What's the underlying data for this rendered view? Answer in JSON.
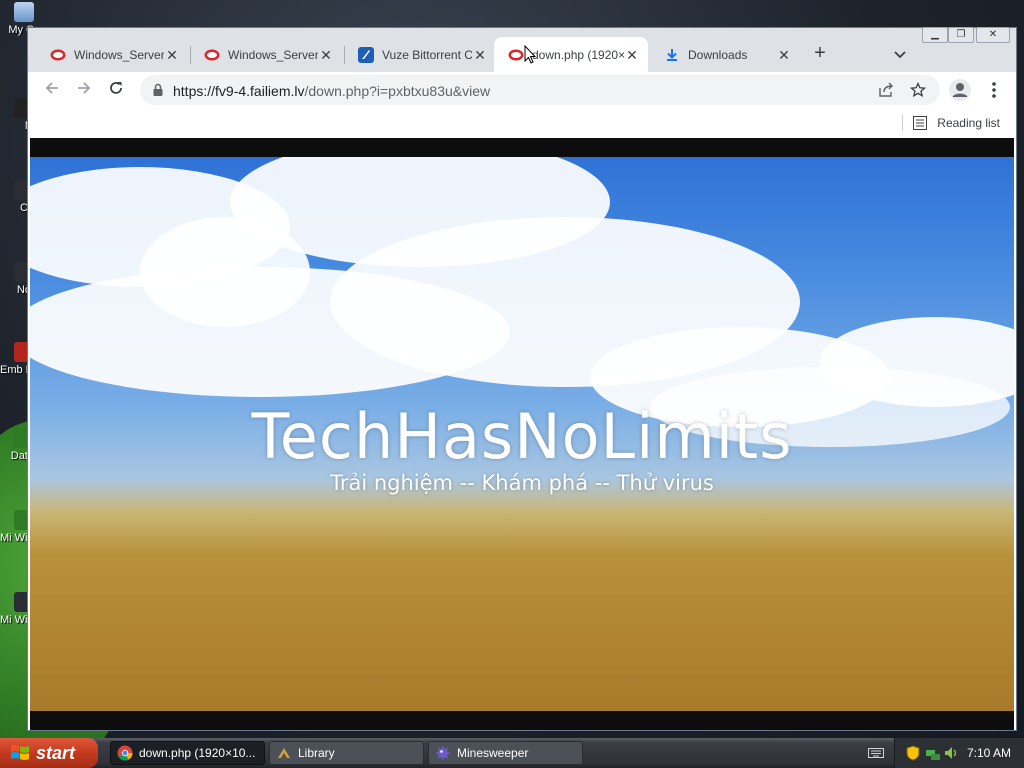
{
  "desktop": {
    "icons": [
      "My C",
      "M",
      "Ch",
      "Not",
      "Emb De",
      "Data",
      "Mi Wind",
      "Mi Wind"
    ]
  },
  "browser": {
    "tabs": [
      {
        "title": "Windows_Server_",
        "icon": "red-oval-favicon",
        "active": false
      },
      {
        "title": "Windows_Server_",
        "icon": "red-oval-favicon",
        "active": false
      },
      {
        "title": "Vuze Bittorrent Cli",
        "icon": "vuze-favicon",
        "active": false
      },
      {
        "title": "down.php (1920×",
        "icon": "red-oval-favicon",
        "active": true
      },
      {
        "title": "Downloads",
        "icon": "download-icon",
        "active": false
      }
    ],
    "url_host": "https://fv9-4.failiem.lv",
    "url_path": "/down.php?i=pxbtxu83u&view",
    "reading_list": "Reading list"
  },
  "page": {
    "title": "TechHasNoLimits",
    "subtitle": "Trải nghiệm -- Khám phá -- Thử virus"
  },
  "taskbar": {
    "start": "start",
    "tasks": [
      {
        "label": "down.php (1920×10...",
        "icon": "chrome-icon",
        "active": true
      },
      {
        "label": "Library",
        "icon": "library-icon",
        "active": false
      },
      {
        "label": "Minesweeper",
        "icon": "minesweeper-icon",
        "active": false
      }
    ],
    "time": "7:10 AM"
  },
  "colors": {
    "tabstrip": "#dee1e6",
    "omnibox": "#f1f3f4",
    "start": "#c33a1d",
    "taskbar": "#2e3237"
  }
}
